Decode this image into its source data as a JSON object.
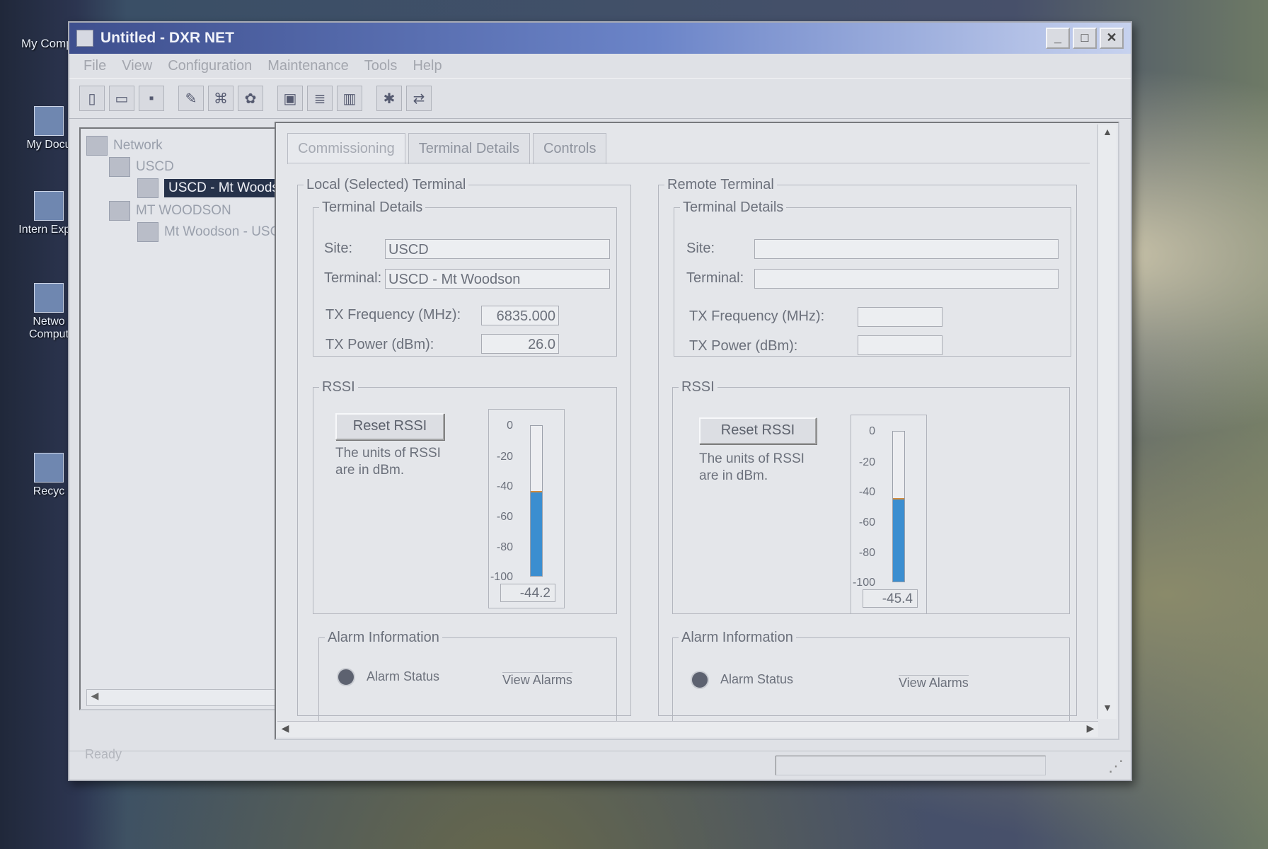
{
  "desktop": {
    "top_label": "My Computer",
    "top_label2": "",
    "icons": [
      {
        "label": "My Docu"
      },
      {
        "label": "Intern Explo"
      },
      {
        "label": "Netwo Comput"
      },
      {
        "label": "Recyc"
      }
    ]
  },
  "window": {
    "title": "Untitled - DXR NET",
    "minimize_glyph": "_",
    "maximize_glyph": "□",
    "close_glyph": "✕"
  },
  "menu": [
    "File",
    "View",
    "Configuration",
    "Maintenance",
    "Tools",
    "Help"
  ],
  "toolbar": {
    "buttons": [
      {
        "icon": "new-icon",
        "glyph": "▯"
      },
      {
        "icon": "open-icon",
        "glyph": "▭"
      },
      {
        "icon": "save-icon",
        "glyph": "▪"
      },
      {
        "icon": "pencil-icon",
        "glyph": "✎"
      },
      {
        "icon": "tree-icon",
        "glyph": "⌘"
      },
      {
        "icon": "settings-icon",
        "glyph": "✿"
      },
      {
        "icon": "terminal-icon",
        "glyph": "▣"
      },
      {
        "icon": "list-icon",
        "glyph": "≣"
      },
      {
        "icon": "chart-icon",
        "glyph": "▥"
      },
      {
        "icon": "network-icon",
        "glyph": "✱"
      },
      {
        "icon": "link-icon",
        "glyph": "⇄"
      }
    ]
  },
  "tree": {
    "items": [
      {
        "label": "Network"
      },
      {
        "label": "USCD"
      },
      {
        "label": "USCD - Mt Woodso"
      },
      {
        "label": "MT WOODSON"
      },
      {
        "label": "Mt Woodson - USC"
      }
    ]
  },
  "status": {
    "text": "Ready"
  },
  "tabs": [
    {
      "label": "Commissioning"
    },
    {
      "label": "Terminal Details"
    },
    {
      "label": "Controls"
    }
  ],
  "local": {
    "legend": "Local (Selected) Terminal",
    "details_legend": "Terminal Details",
    "site_label": "Site:",
    "site_value": "USCD",
    "terminal_label": "Terminal:",
    "terminal_value": "USCD - Mt Woodson",
    "tx_freq_label": "TX Frequency (MHz):",
    "tx_freq_value": "6835.000",
    "tx_power_label": "TX Power (dBm):",
    "tx_power_value": "26.0",
    "rssi_legend": "RSSI",
    "reset_label": "Reset RSSI",
    "note1": "The units of RSSI",
    "note2": "are in dBm.",
    "rssi_value": "-44.2",
    "rssi_fraction": 0.558,
    "alarm_legend": "Alarm Information",
    "alarm_status_label": "Alarm Status",
    "view_alarms_label": "View Alarms"
  },
  "remote": {
    "legend": "Remote Terminal",
    "details_legend": "Terminal Details",
    "site_label": "Site:",
    "site_value": "",
    "terminal_label": "Terminal:",
    "terminal_value": "",
    "tx_freq_label": "TX Frequency (MHz):",
    "tx_freq_value": "",
    "tx_power_label": "TX Power (dBm):",
    "tx_power_value": "",
    "rssi_legend": "RSSI",
    "reset_label": "Reset RSSI",
    "note1": "The units of RSSI",
    "note2": "are in dBm.",
    "rssi_value": "-45.4",
    "rssi_fraction": 0.546,
    "alarm_legend": "Alarm Information",
    "alarm_status_label": "Alarm Status",
    "view_alarms_label": "View Alarms"
  },
  "meter_ticks": [
    "0",
    "-20",
    "-40",
    "-60",
    "-80",
    "-100"
  ],
  "colors": {
    "meter_fill": "#3b8ed0",
    "meter_marker": "#d28a3a",
    "titlebar": "#3e4f8e"
  }
}
